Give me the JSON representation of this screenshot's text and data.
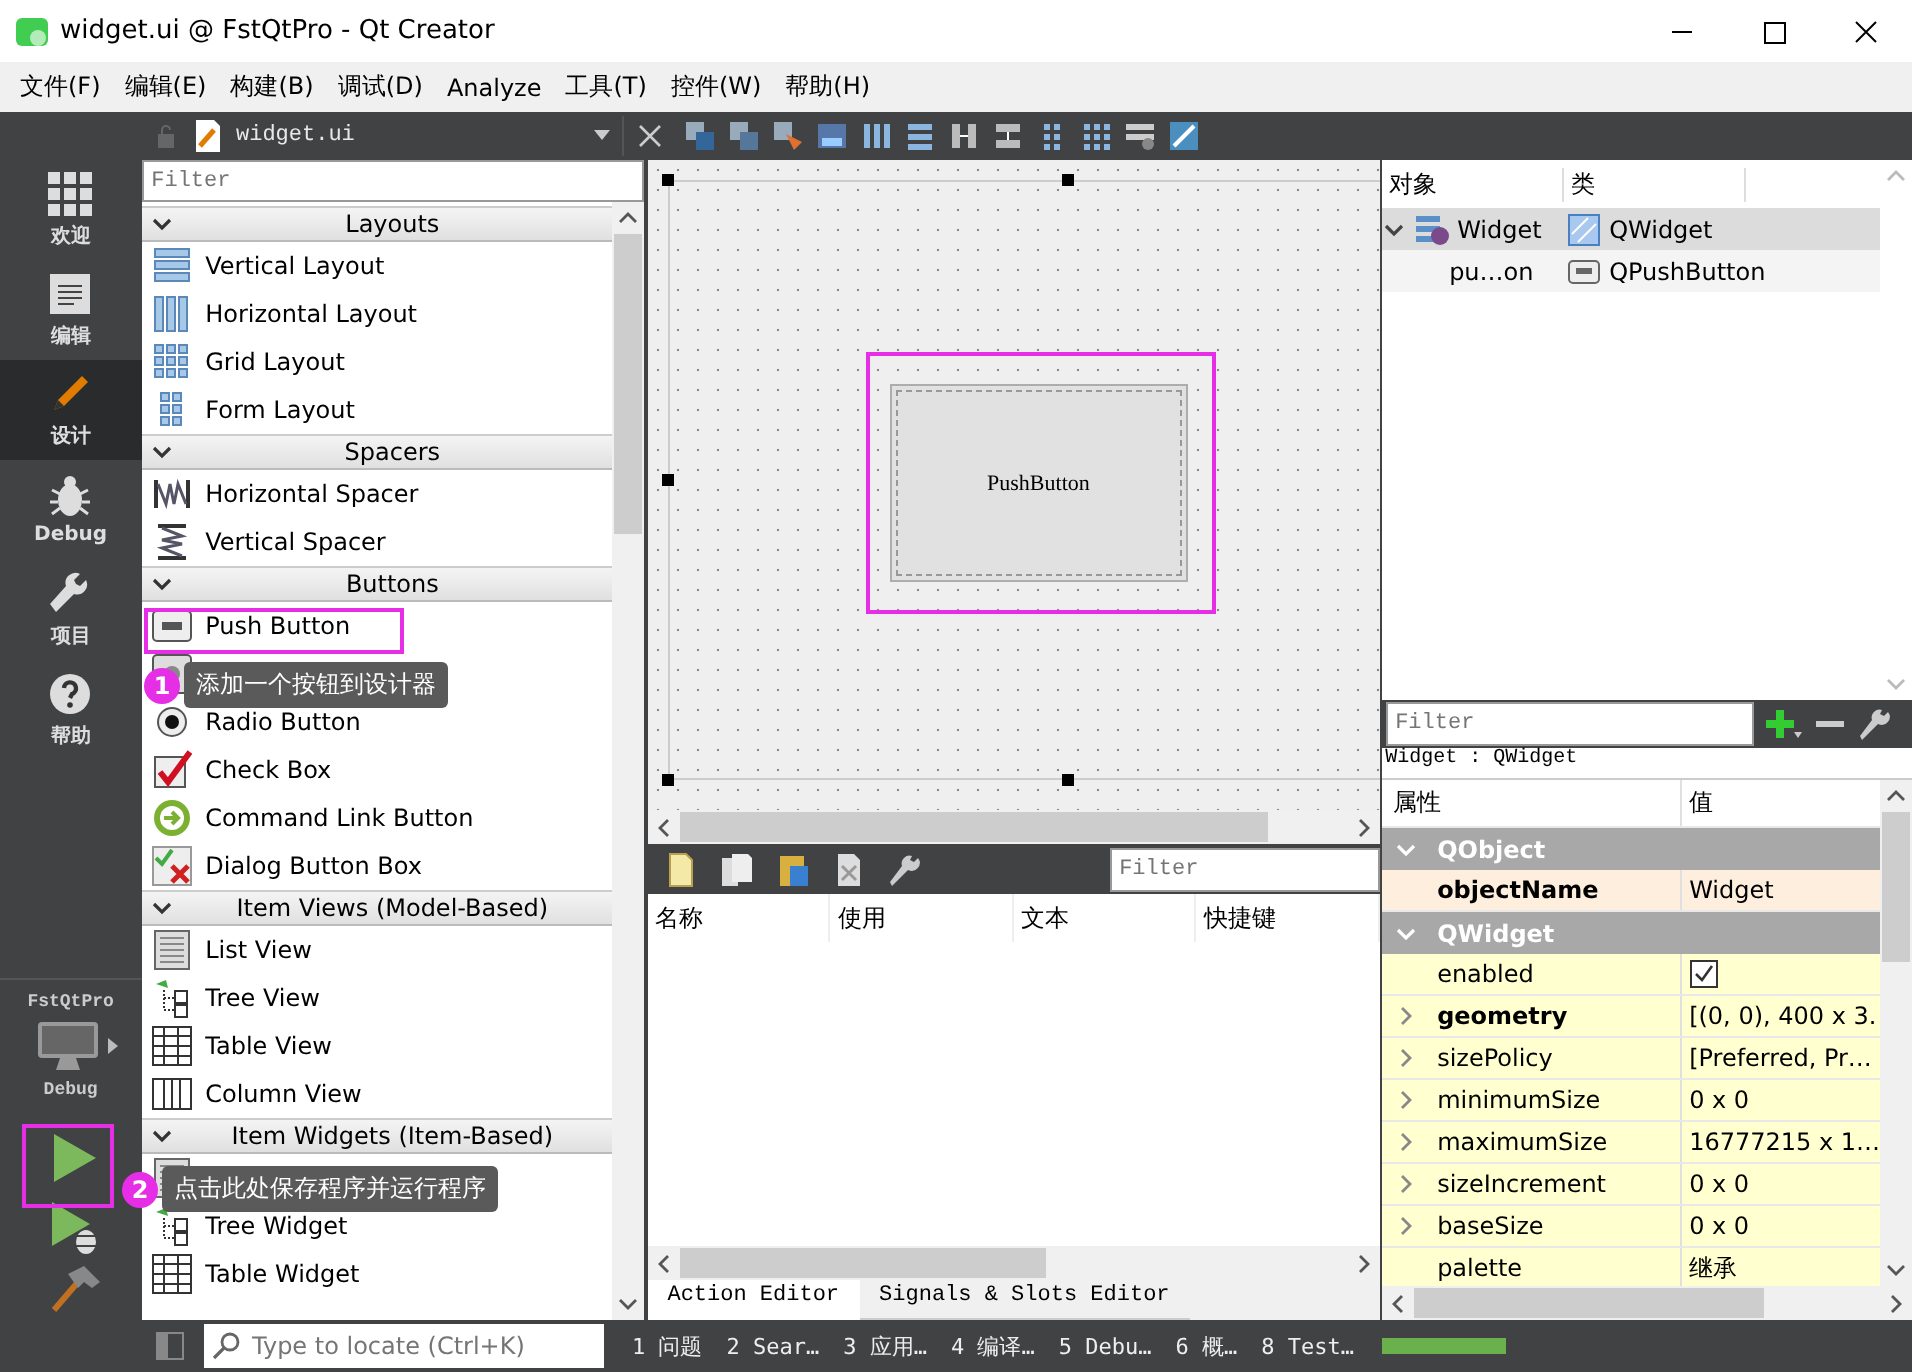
{
  "window": {
    "title": "widget.ui @ FstQtPro - Qt Creator"
  },
  "menu": [
    "文件(F)",
    "编辑(E)",
    "构建(B)",
    "调试(D)",
    "Analyze",
    "工具(T)",
    "控件(W)",
    "帮助(H)"
  ],
  "editor_toolbar": {
    "file": "widget.ui"
  },
  "mode_bar": {
    "modes": [
      {
        "kind": "welcome",
        "label": "欢迎",
        "selected": false
      },
      {
        "kind": "edit",
        "label": "编辑",
        "selected": false
      },
      {
        "kind": "design",
        "label": "设计",
        "selected": true
      },
      {
        "kind": "debug",
        "label": "Debug",
        "selected": false
      },
      {
        "kind": "projects",
        "label": "项目",
        "selected": false
      },
      {
        "kind": "help",
        "label": "帮助",
        "selected": false
      }
    ],
    "project": "FstQtPro",
    "build_config": "Debug"
  },
  "widget_box": {
    "filter_placeholder": "Filter",
    "categories": [
      {
        "title": "Layouts",
        "expanded": true,
        "items": [
          {
            "kind": "vbox",
            "label": "Vertical Layout"
          },
          {
            "kind": "hbox",
            "label": "Horizontal Layout"
          },
          {
            "kind": "grid",
            "label": "Grid Layout"
          },
          {
            "kind": "form",
            "label": "Form Layout"
          }
        ]
      },
      {
        "title": "Spacers",
        "expanded": true,
        "items": [
          {
            "kind": "hspacer",
            "label": "Horizontal Spacer"
          },
          {
            "kind": "vspacer",
            "label": "Vertical Spacer"
          }
        ]
      },
      {
        "title": "Buttons",
        "expanded": true,
        "items": [
          {
            "kind": "pushbutton",
            "label": "Push Button"
          },
          {
            "kind": "toolbutton"
          },
          {
            "kind": "radio",
            "label": "Radio Button"
          },
          {
            "kind": "checkbox",
            "label": "Check Box"
          },
          {
            "kind": "commandlink",
            "label": "Command Link Button"
          },
          {
            "kind": "dialogbuttons",
            "label": "Dialog Button Box"
          }
        ]
      },
      {
        "title": "Item Views (Model-Based)",
        "expanded": true,
        "items": [
          {
            "kind": "list",
            "label": "List View"
          },
          {
            "kind": "tree",
            "label": "Tree View"
          },
          {
            "kind": "table",
            "label": "Table View"
          },
          {
            "kind": "columnview",
            "label": "Column View"
          }
        ]
      },
      {
        "title": "Item Widgets (Item-Based)",
        "expanded": true,
        "items": [
          {
            "kind": "list"
          },
          {
            "kind": "tree",
            "label": "Tree Widget"
          },
          {
            "kind": "table",
            "label": "Table Widget"
          }
        ]
      }
    ]
  },
  "form_editor": {
    "button_text": "PushButton"
  },
  "action_editor": {
    "filter_placeholder": "Filter",
    "columns": [
      "名称",
      "使用",
      "文本",
      "快捷键"
    ],
    "tabs": [
      {
        "label": "Action Editor",
        "selected": true
      },
      {
        "label": "Signals & Slots Editor",
        "selected": false
      }
    ]
  },
  "object_inspector": {
    "columns": [
      "对象",
      "类"
    ],
    "tree": [
      {
        "object": "Widget",
        "class": "QWidget",
        "selected": true,
        "expanded": true,
        "children": [
          {
            "object": "pu…on",
            "class": "QPushButton",
            "selected": false
          }
        ]
      }
    ]
  },
  "property_editor": {
    "filter_placeholder": "Filter",
    "title": "Widget : QWidget",
    "columns": [
      "属性",
      "值"
    ],
    "groups": [
      {
        "name": "QObject",
        "expanded": true,
        "properties": [
          {
            "kind": "text",
            "name": "objectName",
            "value": "Widget",
            "changed": true,
            "expandable": false
          }
        ]
      },
      {
        "name": "QWidget",
        "expanded": true,
        "properties": [
          {
            "kind": "checkbox",
            "name": "enabled",
            "checked": true,
            "changed": false,
            "expandable": false
          },
          {
            "kind": "text",
            "name": "geometry",
            "value": "[(0, 0), 400 x 3.",
            "changed": true,
            "expandable": true
          },
          {
            "kind": "text",
            "name": "sizePolicy",
            "value": "[Preferred, Pr…",
            "changed": false,
            "expandable": true
          },
          {
            "kind": "text",
            "name": "minimumSize",
            "value": "0 x 0",
            "changed": false,
            "expandable": true
          },
          {
            "kind": "text",
            "name": "maximumSize",
            "value": "16777215 x 1…",
            "changed": false,
            "expandable": true
          },
          {
            "kind": "text",
            "name": "sizeIncrement",
            "value": "0 x 0",
            "changed": false,
            "expandable": true
          },
          {
            "kind": "text",
            "name": "baseSize",
            "value": "0 x 0",
            "changed": false,
            "expandable": true
          },
          {
            "kind": "text",
            "name": "palette",
            "value": "继承",
            "changed": false,
            "expandable": false
          }
        ]
      }
    ]
  },
  "status_bar": {
    "locate_placeholder": "Type to locate (Ctrl+K)",
    "panes": [
      "1 问题",
      "2 Sear…",
      "3 应用…",
      "4 编译…",
      "5 Debu…",
      "6 概…",
      "8 Test…"
    ],
    "progress": {
      "level": 1
    }
  },
  "annotations": [
    {
      "number": "1",
      "text": "添加一个按钮到设计器"
    },
    {
      "number": "2",
      "text": "点击此处保存程序并运行程序"
    }
  ]
}
